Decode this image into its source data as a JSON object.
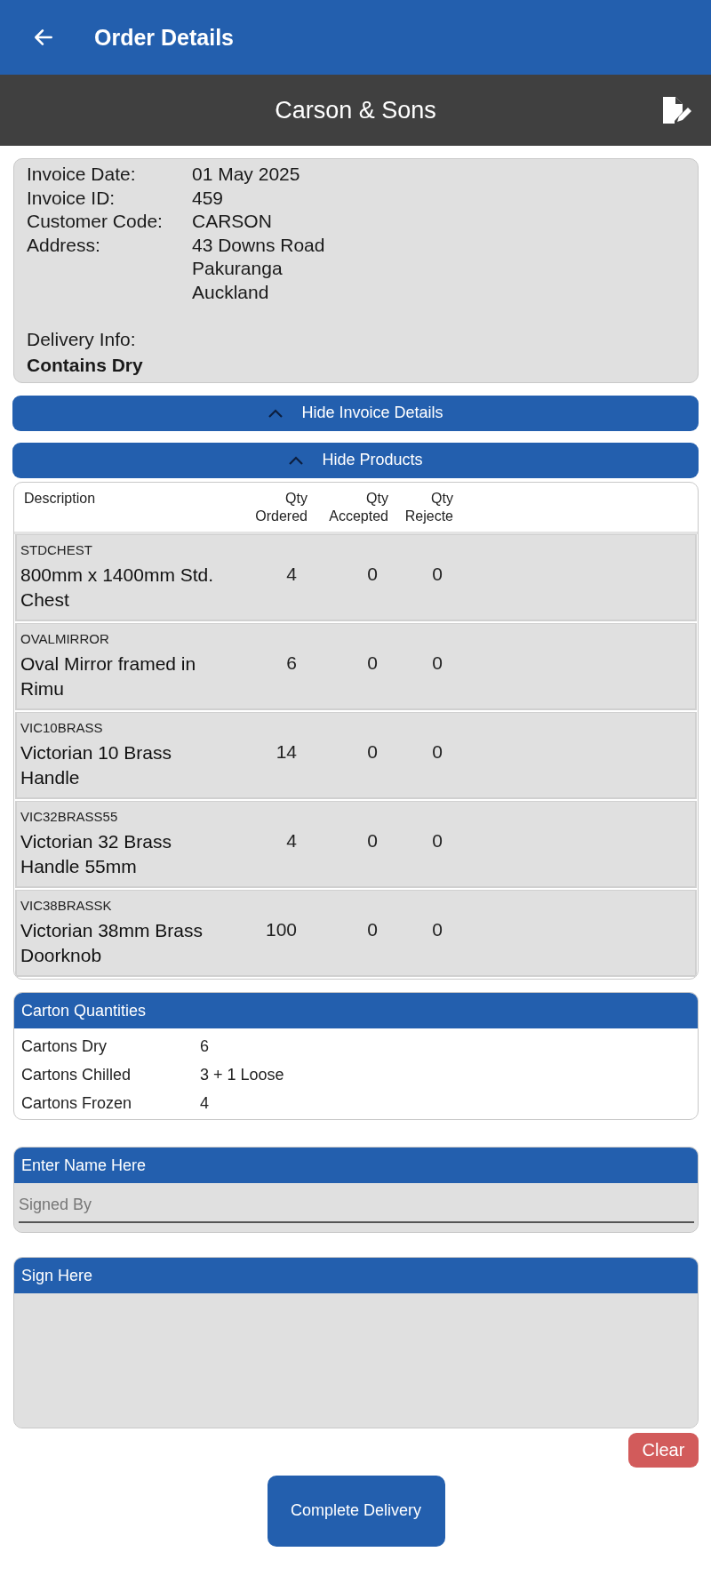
{
  "app_bar": {
    "title": "Order Details"
  },
  "customer_bar": {
    "title": "Carson & Sons"
  },
  "invoice": {
    "fields": [
      {
        "label": "Invoice Date:",
        "lines": [
          "01 May 2025"
        ]
      },
      {
        "label": "Invoice ID:",
        "lines": [
          "459"
        ]
      },
      {
        "label": "Customer Code:",
        "lines": [
          "CARSON"
        ]
      },
      {
        "label": "Address:",
        "lines": [
          "43 Downs Road",
          "Pakuranga",
          "Auckland"
        ]
      }
    ],
    "delivery_label": "Delivery Info:",
    "delivery_value": "Contains Dry"
  },
  "toggles": [
    {
      "label": "Hide Invoice Details",
      "expanded": true
    },
    {
      "label": "Hide Products",
      "expanded": true
    }
  ],
  "products": {
    "columns": [
      "Description",
      "Qty\nOrdered",
      "Qty\nAccepted",
      "Qty\nRejecte"
    ],
    "rows": [
      {
        "code": "STDCHEST",
        "description": "800mm x 1400mm Std. Chest",
        "ordered": "4",
        "accepted": "0",
        "rejected": "0"
      },
      {
        "code": "OVALMIRROR",
        "description": "Oval Mirror framed in Rimu",
        "ordered": "6",
        "accepted": "0",
        "rejected": "0"
      },
      {
        "code": "VIC10BRASS",
        "description": "Victorian 10 Brass Handle",
        "ordered": "14",
        "accepted": "0",
        "rejected": "0"
      },
      {
        "code": "VIC32BRASS55",
        "description": "Victorian 32 Brass Handle 55mm",
        "ordered": "4",
        "accepted": "0",
        "rejected": "0"
      },
      {
        "code": "VIC38BRASSK",
        "description": "Victorian 38mm Brass Doorknob",
        "ordered": "100",
        "accepted": "0",
        "rejected": "0"
      }
    ]
  },
  "cartons": {
    "title": "Carton Quantities",
    "rows": [
      {
        "label": "Cartons Dry",
        "value": "6"
      },
      {
        "label": "Cartons Chilled",
        "value": "3 + 1 Loose"
      },
      {
        "label": "Cartons Frozen",
        "value": "4"
      }
    ]
  },
  "signed_by": {
    "title": "Enter Name Here",
    "placeholder": "Signed By"
  },
  "signature": {
    "title": "Sign Here"
  },
  "buttons": {
    "clear": "Clear",
    "complete": "Complete Delivery"
  }
}
